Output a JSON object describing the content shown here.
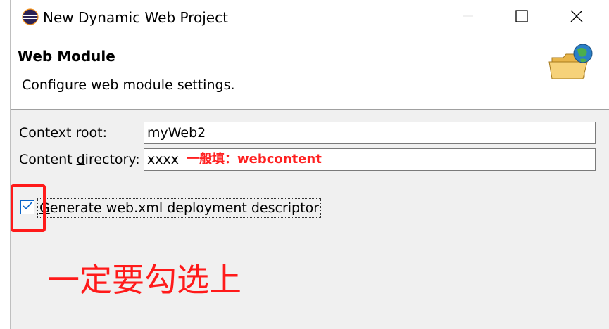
{
  "window": {
    "title": "New Dynamic Web Project",
    "icon": "eclipse-icon",
    "controls": [
      "minimize-icon",
      "maximize-icon",
      "close-icon"
    ]
  },
  "header": {
    "title": "Web Module",
    "description": "Configure web module settings.",
    "icon": "folder-globe-icon"
  },
  "form": {
    "context_root": {
      "label_pre": "Context ",
      "label_mnemonic": "r",
      "label_post": "oot:",
      "value": "myWeb2"
    },
    "content_directory": {
      "label_pre": "Content ",
      "label_mnemonic": "d",
      "label_post": "irectory:",
      "value": "xxxx"
    },
    "generate_xml": {
      "checked": true,
      "label_mnemonic": "G",
      "label_post": "enerate web.xml deployment descriptor"
    }
  },
  "annotations": {
    "inline_hint": "一般填：webcontent",
    "big_note": "一定要勾选上",
    "color": "#ff1a1a"
  }
}
